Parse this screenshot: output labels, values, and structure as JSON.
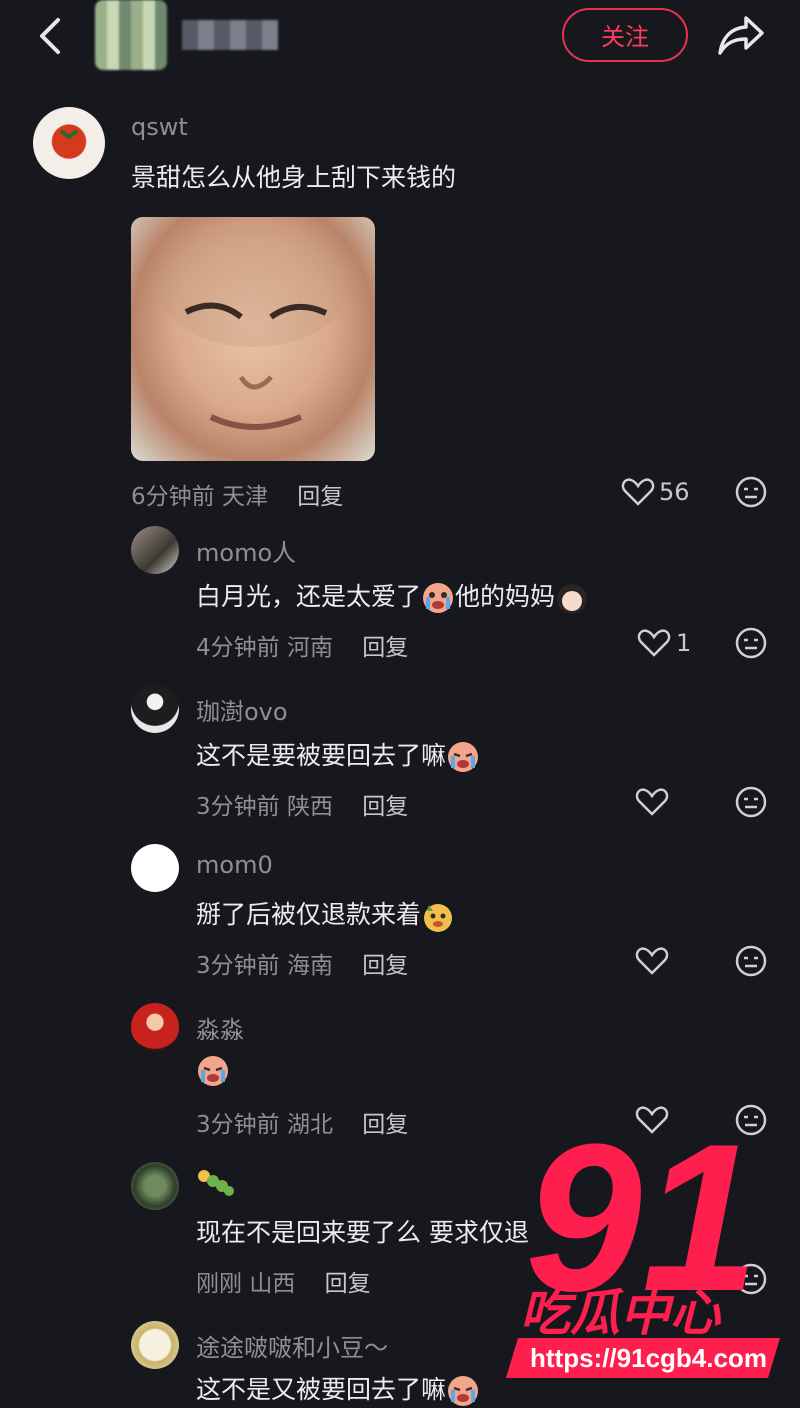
{
  "header": {
    "follow_label": "关注"
  },
  "comments": [
    {
      "user": "qswt",
      "text": "景甜怎么从他身上刮下来钱的",
      "time": "6分钟前",
      "location": "天津",
      "reply": "回复",
      "likes": "56"
    },
    {
      "user": "momo人",
      "text": "白月光，还是太爱了",
      "text2": "他的妈妈",
      "time": "4分钟前",
      "location": "河南",
      "reply": "回复",
      "likes": "1"
    },
    {
      "user": "珈澍ovo",
      "text": "这不是要被要回去了嘛",
      "time": "3分钟前",
      "location": "陕西",
      "reply": "回复",
      "likes": ""
    },
    {
      "user": "mom0",
      "text": "掰了后被仅退款来着",
      "time": "3分钟前",
      "location": "海南",
      "reply": "回复",
      "likes": ""
    },
    {
      "user": "淼淼",
      "text": "",
      "time": "3分钟前",
      "location": "湖北",
      "reply": "回复",
      "likes": ""
    },
    {
      "user": "",
      "text": "现在不是回来要了么 要求仅退",
      "time": "刚刚",
      "location": "山西",
      "reply": "回复",
      "likes": ""
    },
    {
      "user": "途途啵啵和小豆～",
      "text": "这不是又被要回去了嘛",
      "time": "",
      "location": "",
      "reply": "",
      "likes": ""
    }
  ],
  "watermark": {
    "number": "91",
    "name": "吃瓜中心",
    "url": "https://91cgb4.com",
    "color": "#ff1f4f"
  },
  "colors": {
    "background": "#17171e",
    "accent": "#e5334f"
  }
}
